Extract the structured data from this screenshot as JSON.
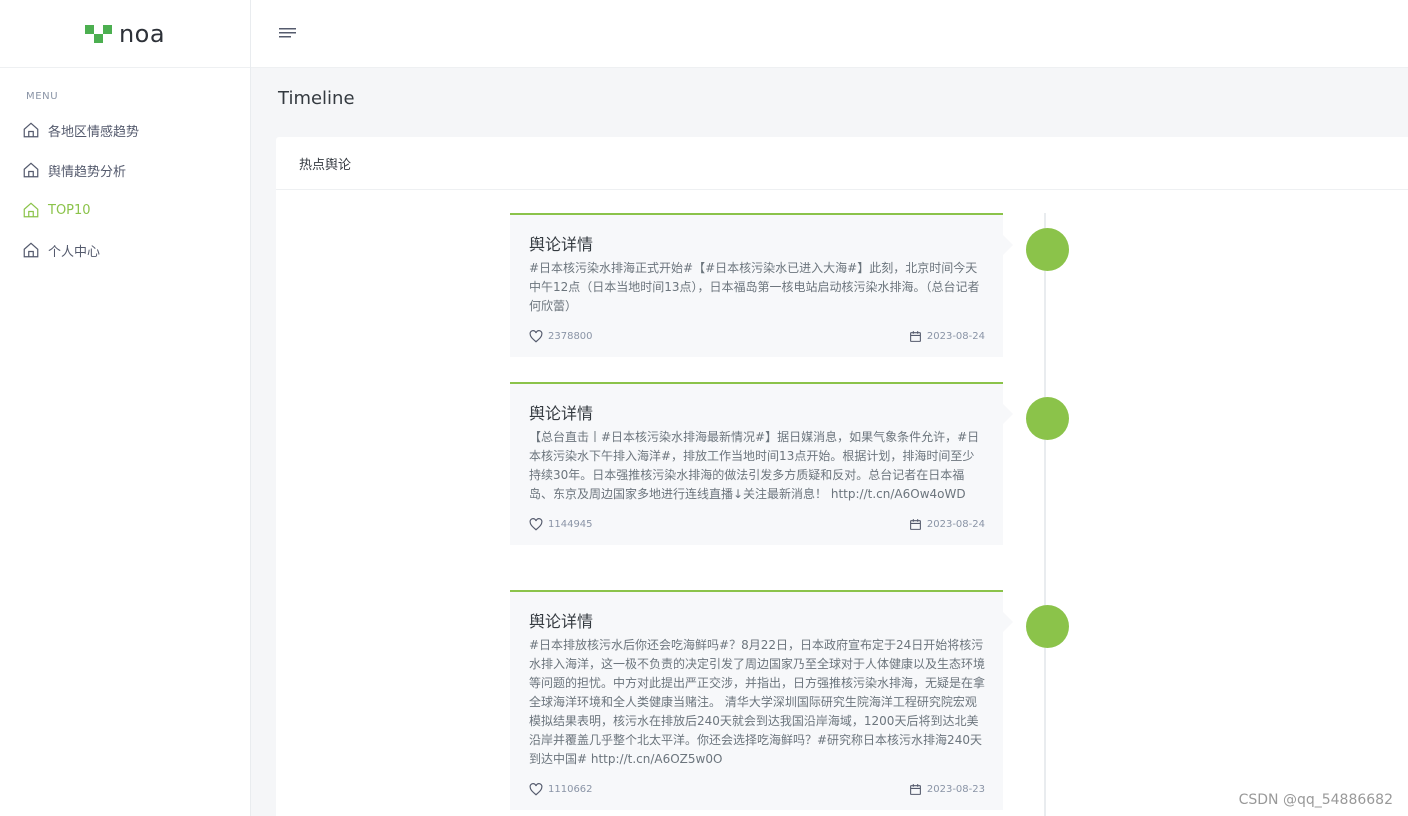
{
  "brand": {
    "name": "noa"
  },
  "sidebar": {
    "menu_title": "MENU",
    "items": [
      {
        "label": "各地区情感趋势",
        "icon": "home-icon"
      },
      {
        "label": "舆情趋势分析",
        "icon": "home-icon"
      },
      {
        "label": "TOP10",
        "icon": "home-icon",
        "active": true
      },
      {
        "label": "个人中心",
        "icon": "home-icon"
      }
    ]
  },
  "header": {
    "page_title": "Timeline"
  },
  "card": {
    "title": "热点舆论"
  },
  "events": [
    {
      "title": "舆论详情",
      "text": "#日本核污染水排海正式开始#【#日本核污染水已进入大海#】此刻，北京时间今天中午12点（日本当地时间13点），日本福岛第一核电站启动核污染水排海。（总台记者何欣蕾）",
      "likes": "2378800",
      "date": "2023-08-24"
    },
    {
      "title": "舆论详情",
      "text": "【总台直击丨#日本核污染水排海最新情况#】据日媒消息，如果气象条件允许，#日本核污染水下午排入海洋#，排放工作当地时间13点开始。根据计划，排海时间至少持续30年。日本强推核污染水排海的做法引发多方质疑和反对。总台记者在日本福岛、东京及周边国家多地进行连线直播↓关注最新消息！ http://t.cn/A6Ow4oWD",
      "likes": "1144945",
      "date": "2023-08-24"
    },
    {
      "title": "舆论详情",
      "text": "#日本排放核污水后你还会吃海鲜吗#？8月22日，日本政府宣布定于24日开始将核污水排入海洋，这一极不负责的决定引发了周边国家乃至全球对于人体健康以及生态环境等问题的担忧。中方对此提出严正交涉，并指出，日方强推核污染水排海，无疑是在拿全球海洋环境和全人类健康当赌注。 清华大学深圳国际研究生院海洋工程研究院宏观模拟结果表明，核污水在排放后240天就会到达我国沿岸海域，1200天后将到达北美沿岸并覆盖几乎整个北太平洋。你还会选择吃海鲜吗？#研究称日本核污水排海240天到达中国# http://t.cn/A6OZ5w0O",
      "likes": "1110662",
      "date": "2023-08-23"
    }
  ],
  "watermark": "CSDN @qq_54886682",
  "colors": {
    "accent": "#8bc34a",
    "logo": "#4caf50"
  }
}
